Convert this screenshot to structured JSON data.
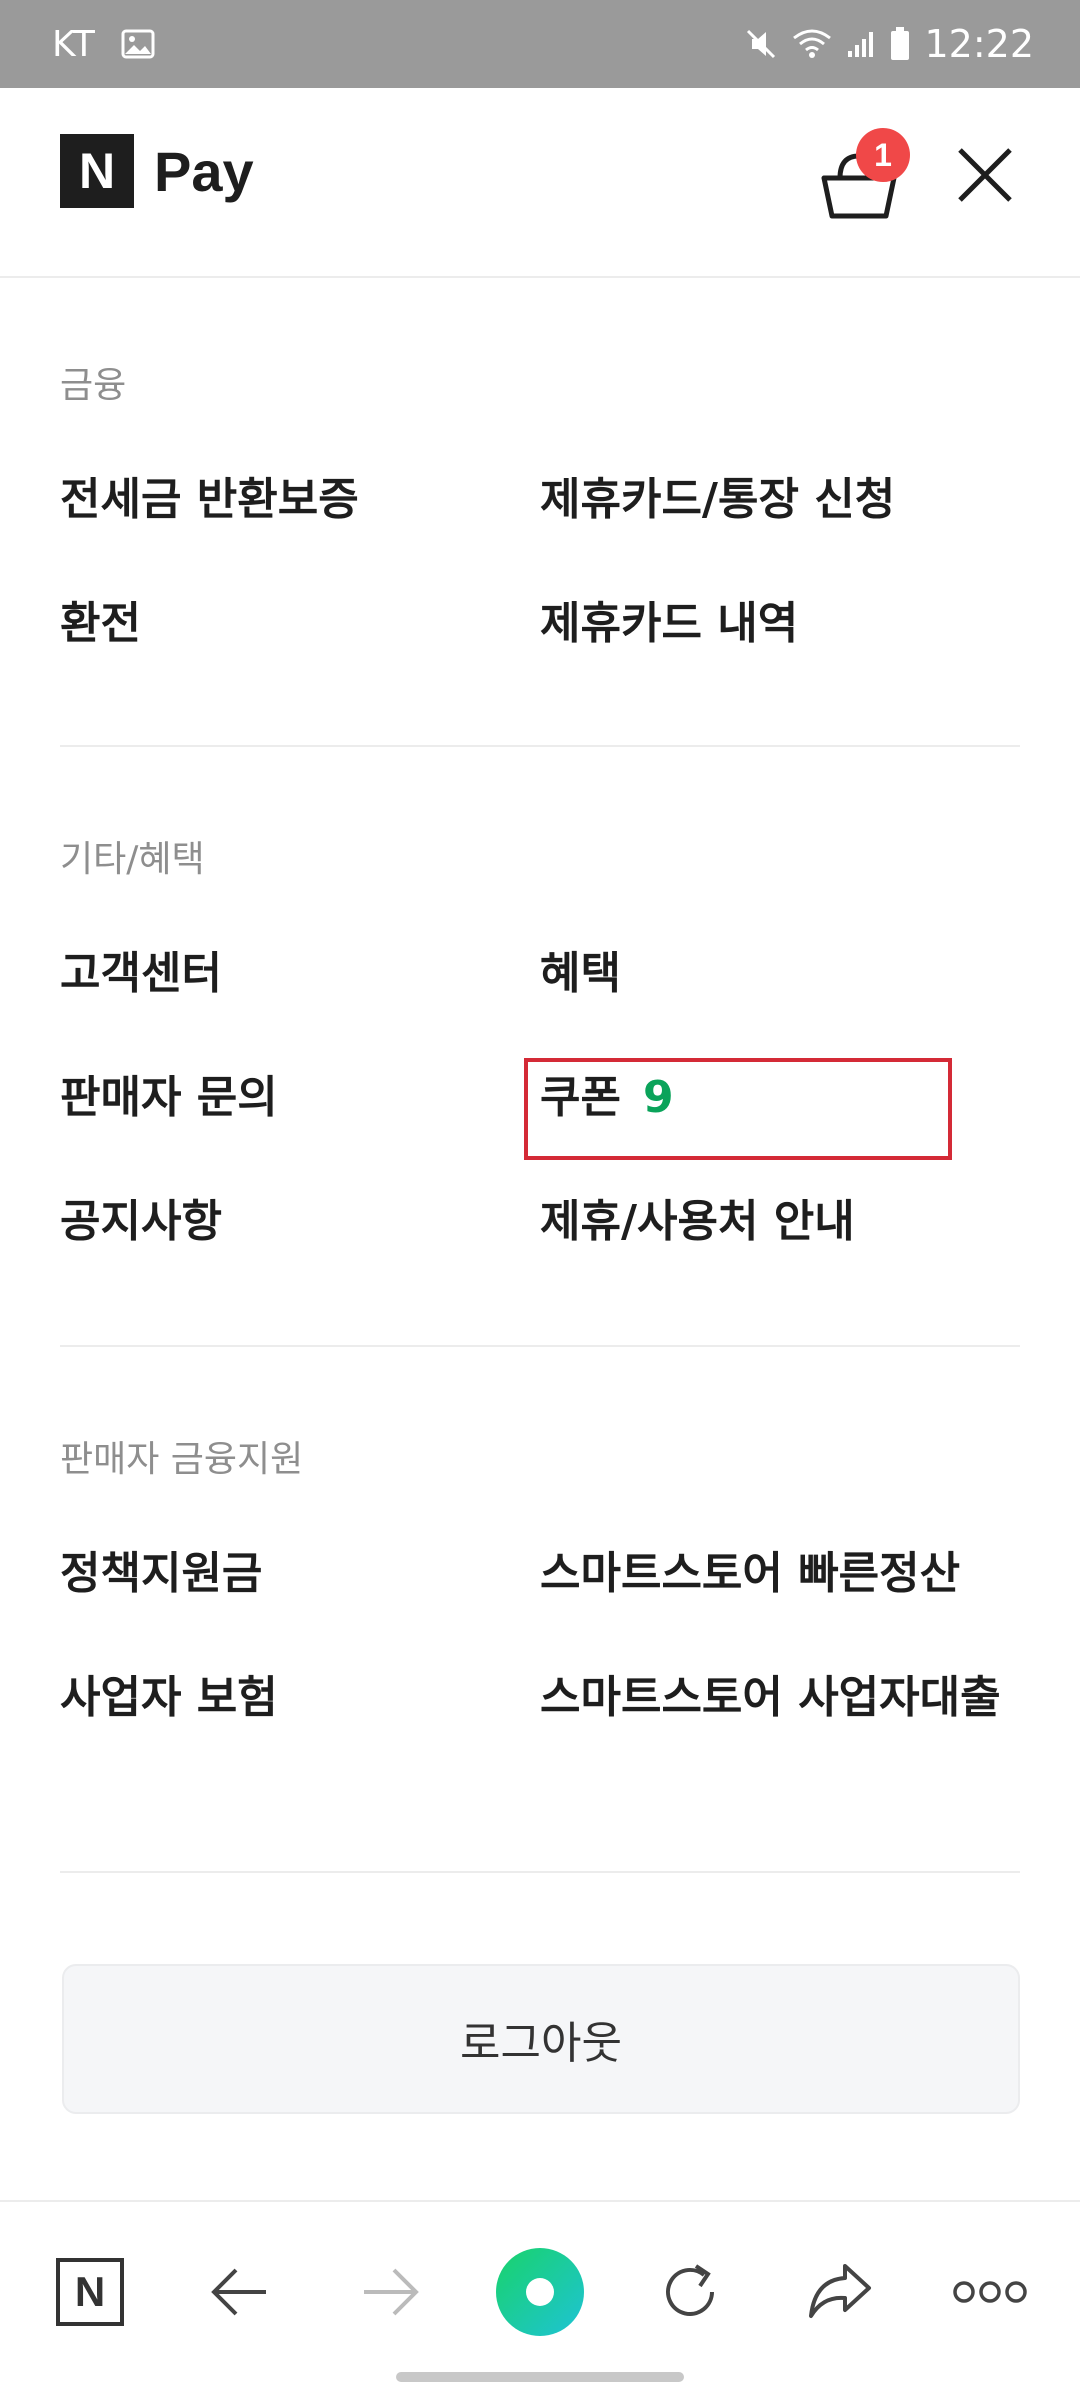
{
  "status_bar": {
    "carrier": "KT",
    "time": "12:22"
  },
  "header": {
    "logo_letter": "N",
    "brand": "Pay",
    "cart_count": "1"
  },
  "sections": [
    {
      "title": "금융",
      "items": [
        "전세금 반환보증",
        "제휴카드/통장 신청",
        "환전",
        "제휴카드 내역"
      ]
    },
    {
      "title": "기타/혜택",
      "items": [
        "고객센터",
        "혜택",
        "판매자 문의",
        "쿠폰",
        "공지사항",
        "제휴/사용처 안내"
      ],
      "coupon_count": "9"
    },
    {
      "title": "판매자 금융지원",
      "items": [
        "정책지원금",
        "스마트스토어 빠른정산",
        "사업자 보험",
        "스마트스토어 사업자대출"
      ]
    }
  ],
  "logout_label": "로그아웃",
  "bottom_nav": {
    "logo_letter": "N"
  },
  "colors": {
    "accent_green": "#0aa35a",
    "badge_red": "#f04848",
    "highlight_red": "#d42a36"
  }
}
